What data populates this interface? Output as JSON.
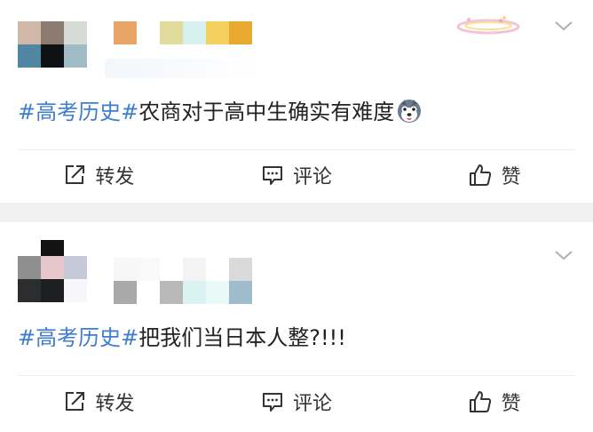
{
  "posts": [
    {
      "topic": "#高考历史#",
      "text": "农商对于高中生确实有难度",
      "emoji": "husky-face-emoji",
      "actions": {
        "repost": "转发",
        "comment": "评论",
        "like": "赞"
      }
    },
    {
      "topic": "#高考历史#",
      "text": "把我们当日本人整?!!!",
      "actions": {
        "repost": "转发",
        "comment": "评论",
        "like": "赞"
      }
    }
  ],
  "colors": {
    "topic": "#3f7dd1",
    "separator": "#f0f0f0",
    "text": "#222222"
  }
}
